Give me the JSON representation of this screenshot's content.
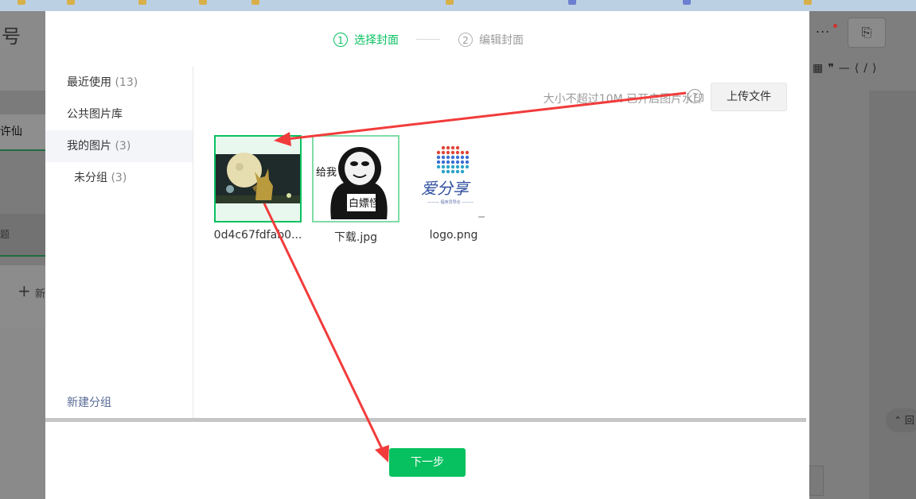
{
  "background": {
    "page_title": "号",
    "tab_label": "许仙",
    "panel_label": "题",
    "new_label": "新",
    "more_label": "...",
    "scroll_top_label": "回"
  },
  "steps": [
    {
      "num": "1",
      "label": "选择封面",
      "active": true
    },
    {
      "num": "2",
      "label": "编辑封面",
      "active": false
    }
  ],
  "sidebar": {
    "items": [
      {
        "label": "最近使用",
        "count": "(13)"
      },
      {
        "label": "公共图片库",
        "count": ""
      },
      {
        "label": "我的图片",
        "count": "(3)"
      },
      {
        "label": "未分组",
        "count": "(3)"
      }
    ],
    "new_group": "新建分组"
  },
  "upload": {
    "tip": "大小不超过10M 已开启图片水印",
    "help_icon": "?",
    "button": "上传文件"
  },
  "images": [
    {
      "name": "0d4c67fdfab0...",
      "state": "selected",
      "icon": "pikachu-moon-thumbnail"
    },
    {
      "name": "下载.jpg",
      "state": "hover",
      "thumb_text_top": "给我",
      "thumb_text_bottom": "白嫖怪",
      "icon": "panda-meme-thumbnail"
    },
    {
      "name": "logo.png",
      "state": "none",
      "logo_text": "爱分享",
      "logo_sub": "——— 程序员导论 ———",
      "icon": "logo-thumbnail"
    }
  ],
  "footer": {
    "next_button": "下一步"
  },
  "colors": {
    "accent": "#07c160",
    "annotation_arrow": "#f23b3b"
  }
}
